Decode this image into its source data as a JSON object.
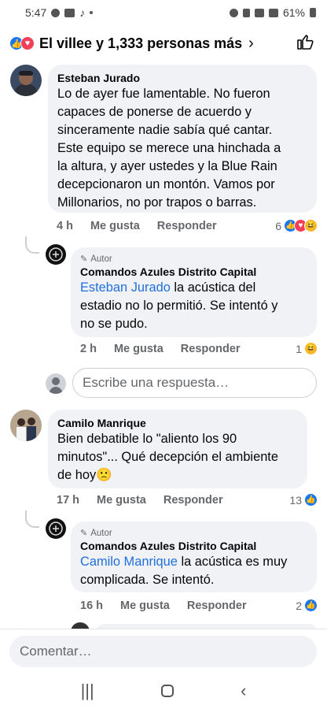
{
  "status_bar": {
    "time": "5:47",
    "battery": "61%"
  },
  "header": {
    "title": "El villee y 1,333 personas más",
    "chevron": "›"
  },
  "comments": [
    {
      "author": "Esteban Jurado",
      "text_lines": [
        "Lo de ayer fue lamentable. No fueron",
        "capaces de ponerse de acuerdo y",
        "sinceramente nadie sabía qué cantar.",
        "Este equipo se merece una hinchada a",
        "la altura, y ayer ustedes y la Blue Rain",
        "decepcionaron un montón. Vamos por",
        "Millonarios, no por trapos o barras."
      ],
      "time": "4 h",
      "like": "Me gusta",
      "reply": "Responder",
      "reaction_count": "6"
    },
    {
      "badge": "Autor",
      "author": "Comandos Azules Distrito Capital",
      "mention": "Esteban Jurado",
      "text_first": " la acústica del",
      "text_lines": [
        "estadio no lo permitió.  Se intentó y",
        "no se pudo."
      ],
      "time": "2 h",
      "like": "Me gusta",
      "reply": "Responder",
      "reaction_count": "1"
    },
    {
      "author": "Camilo Manrique",
      "text_lines": [
        "Bien debatible lo \"aliento los 90",
        "minutos\"... Qué decepción el ambiente",
        "de hoy🙁"
      ],
      "time": "17 h",
      "like": "Me gusta",
      "reply": "Responder",
      "reaction_count": "13"
    },
    {
      "badge": "Autor",
      "author": "Comandos Azules Distrito Capital",
      "mention": "Camilo Manrique",
      "text_first": " la acústica es muy",
      "text_lines": [
        "complicada. Se intentó."
      ],
      "time": "16 h",
      "like": "Me gusta",
      "reply": "Responder",
      "reaction_count": "2"
    }
  ],
  "reply_input": {
    "placeholder": "Escribe una respuesta…"
  },
  "comment_input": {
    "placeholder": "Comentar…"
  },
  "colors": {
    "link": "#216fdb",
    "like": "#1877f2",
    "love": "#f33e58",
    "haha": "#f7b928",
    "bubble": "#f0f2f5"
  }
}
